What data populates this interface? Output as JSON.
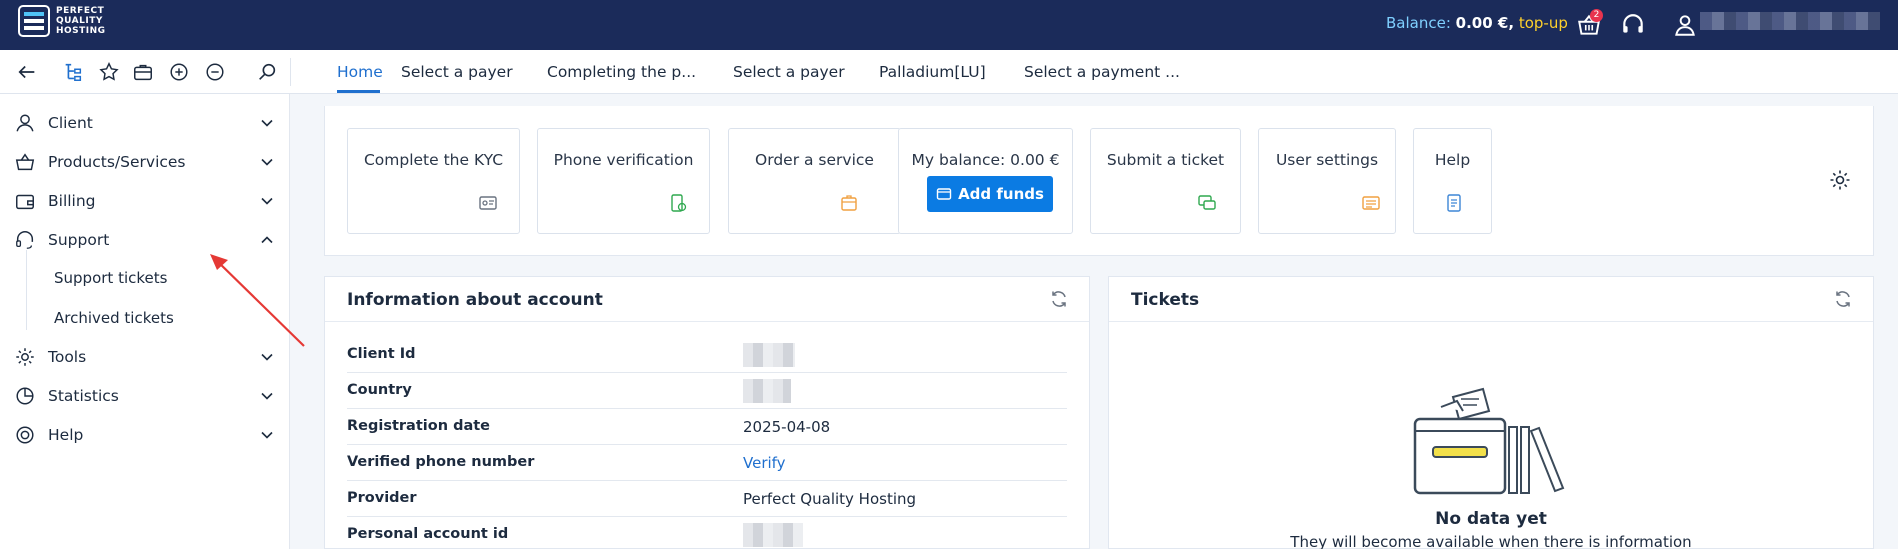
{
  "header": {
    "logo_lines": [
      "PERFECT",
      "QUALITY",
      "HOSTING"
    ],
    "balance_label": "Balance:",
    "balance_value": "0.00 €,",
    "topup_label": "top-up",
    "cart_count": "2"
  },
  "tabs": [
    {
      "label": "Home",
      "active": true
    },
    {
      "label": "Select a payer",
      "active": false
    },
    {
      "label": "Completing the p...",
      "active": false
    },
    {
      "label": "Select a payer",
      "active": false
    },
    {
      "label": "Palladium[LU]",
      "active": false
    },
    {
      "label": "Select a payment ...",
      "active": false
    }
  ],
  "sidebar": {
    "items": [
      {
        "label": "Client",
        "icon": "user-icon",
        "expanded": false
      },
      {
        "label": "Products/Services",
        "icon": "basket-icon",
        "expanded": false
      },
      {
        "label": "Billing",
        "icon": "wallet-icon",
        "expanded": false
      },
      {
        "label": "Support",
        "icon": "headset-icon",
        "expanded": true
      },
      {
        "label": "Tools",
        "icon": "gear-icon",
        "expanded": false
      },
      {
        "label": "Statistics",
        "icon": "pie-chart-icon",
        "expanded": false
      },
      {
        "label": "Help",
        "icon": "lifebuoy-icon",
        "expanded": false
      }
    ],
    "support_sub": [
      "Support tickets",
      "Archived tickets"
    ]
  },
  "quick": {
    "kyc": "Complete the KYC",
    "phone": "Phone verification",
    "order": "Order a service",
    "balance": "My balance: 0.00 €",
    "add_funds": "Add funds",
    "ticket": "Submit a ticket",
    "settings": "User settings",
    "help": "Help"
  },
  "account": {
    "title": "Information about account",
    "rows": [
      {
        "key": "Client Id",
        "value": ""
      },
      {
        "key": "Country",
        "value": ""
      },
      {
        "key": "Registration date",
        "value": "2025-04-08"
      },
      {
        "key": "Verified phone number",
        "value": "Verify"
      },
      {
        "key": "Provider",
        "value": "Perfect Quality Hosting"
      },
      {
        "key": "Personal account id",
        "value": ""
      }
    ]
  },
  "tickets": {
    "title": "Tickets",
    "empty_title": "No data yet",
    "empty_sub": "They will become available when there is information"
  },
  "colors": {
    "header_bg": "#1b2b5a",
    "accent": "#1f6fce",
    "topup": "#ffd12b",
    "button": "#0b7be3"
  }
}
